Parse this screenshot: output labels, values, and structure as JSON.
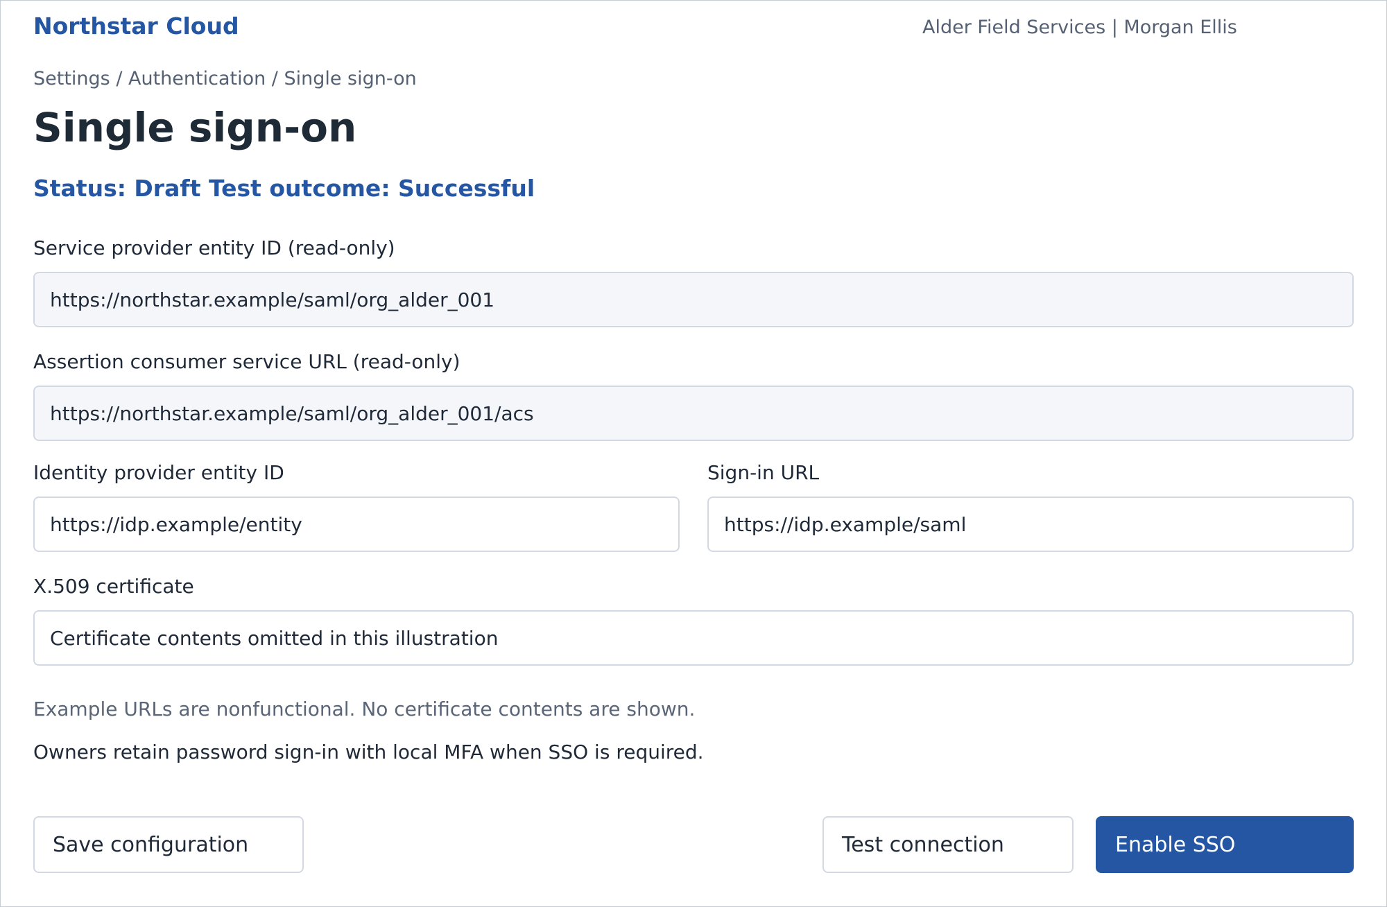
{
  "header": {
    "brand": "Northstar Cloud",
    "account": "Alder Field Services | Morgan Ellis"
  },
  "breadcrumb": "Settings / Authentication / Single sign-on",
  "page_title": "Single sign-on",
  "status_line": "Status: Draft Test outcome: Successful",
  "fields": {
    "sp_entity_id": {
      "label": "Service provider entity ID (read-only)",
      "value": "https://northstar.example/saml/org_alder_001"
    },
    "acs_url": {
      "label": "Assertion consumer service URL (read-only)",
      "value": "https://northstar.example/saml/org_alder_001/acs"
    },
    "idp_entity_id": {
      "label": "Identity provider entity ID",
      "value": "https://idp.example/entity"
    },
    "sign_in_url": {
      "label": "Sign-in URL",
      "value": "https://idp.example/saml"
    },
    "certificate": {
      "label": "X.509 certificate",
      "value": "Certificate contents omitted in this illustration"
    }
  },
  "notes": {
    "disclaimer": "Example URLs are nonfunctional. No certificate contents are shown.",
    "owner_policy": "Owners retain password sign-in with local MFA when SSO is required."
  },
  "buttons": {
    "save": "Save configuration",
    "test": "Test connection",
    "enable": "Enable SSO"
  },
  "colors": {
    "accent": "#2456a3",
    "muted_text": "#556173",
    "readonly_bg": "#f4f6fa",
    "border": "#d3d9e3"
  }
}
